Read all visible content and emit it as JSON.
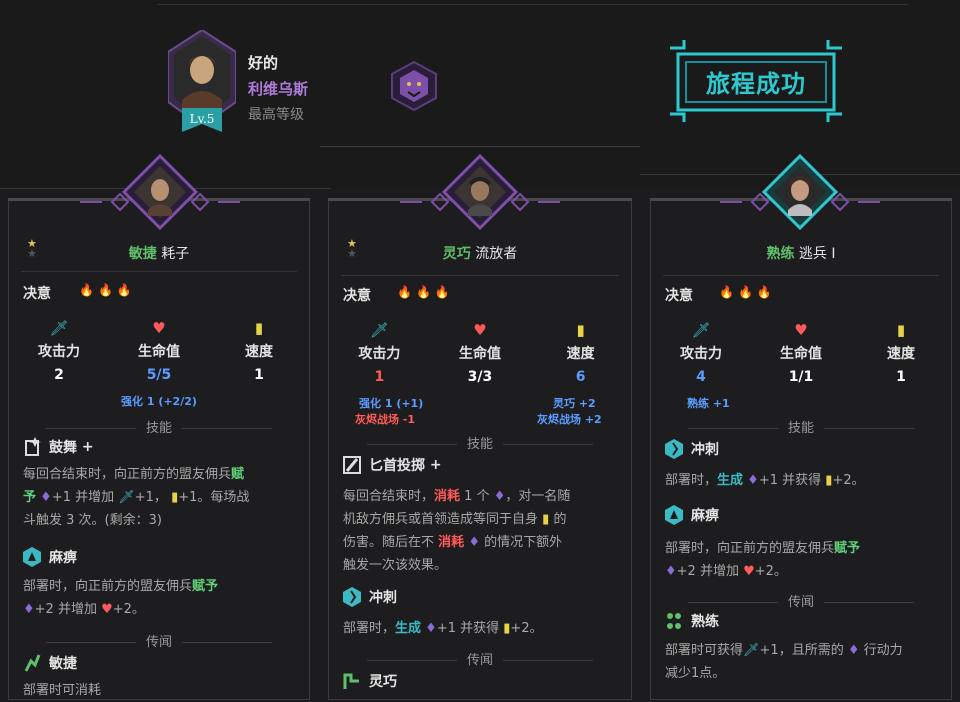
{
  "hero": {
    "mood": "好的",
    "name": "利维乌斯",
    "level_text": "最高等级",
    "badge": "Lv.5"
  },
  "banner": {
    "text": "旅程成功"
  },
  "colors": {
    "accent": "#2ec9cf",
    "purple": "#7d4fa8",
    "trait_green": "#5fbf6a",
    "red": "#ff5a5a",
    "blue": "#5a9dff"
  },
  "cards": [
    {
      "trait": "敏捷",
      "cls": "耗子",
      "resolve": "决意",
      "stats": {
        "atk_label": "攻击力",
        "atk": "2",
        "hp_label": "生命值",
        "hp": "5/5",
        "spd_label": "速度",
        "spd": "1"
      },
      "mod_line": "强化 1 (+2/2)",
      "skills_header": "技能",
      "skill1": {
        "name": "鼓舞",
        "plus": "+",
        "l1a": "每回合结束时，向正前方的盟友佣兵",
        "l1b": "赋",
        "l2a": "予",
        "l2b": "+1 并增加",
        "l2c": "+1，",
        "l2d": "+1。每场战",
        "l3": "斗触发 3 次。(剩余：3)"
      },
      "skill2": {
        "name": "麻痹",
        "l1a": "部署时，向正前方的盟友佣兵",
        "l1b": "赋予",
        "l2a": "+2 并增加",
        "l2b": "+2。"
      },
      "lore_header": "传闻",
      "skill3": {
        "name": "敏捷",
        "l1": "部署时可消耗"
      }
    },
    {
      "trait": "灵巧",
      "cls": "流放者",
      "resolve": "决意",
      "stats": {
        "atk_label": "攻击力",
        "atk": "1",
        "hp_label": "生命值",
        "hp": "3/3",
        "spd_label": "速度",
        "spd": "6"
      },
      "mod_atk1": "强化 1 (+1)",
      "mod_atk2": "灰烬战场 -1",
      "mod_spd1": "灵巧 +2",
      "mod_spd2": "灰烬战场 +2",
      "skills_header": "技能",
      "skill1": {
        "name": "匕首投掷",
        "plus": "+",
        "l1a": "每回合结束时，",
        "l1b": "消耗",
        "l1c": "1 个",
        "l1d": "，对一名随",
        "l2a": "机敌方佣兵或首领造成等同于自身",
        "l2b": "的",
        "l3a": "伤害。随后在不",
        "l3b": "消耗",
        "l3c": "的情况下额外",
        "l4": "触发一次该效果。"
      },
      "skill2": {
        "name": "冲刺",
        "l1a": "部署时，",
        "l1b": "生成",
        "l1c": "+1 并获得",
        "l1d": "+2。"
      },
      "lore_header": "传闻",
      "skill3": {
        "name": "灵巧"
      }
    },
    {
      "trait": "熟练",
      "cls": "逃兵 I",
      "resolve": "决意",
      "stats": {
        "atk_label": "攻击力",
        "atk": "4",
        "hp_label": "生命值",
        "hp": "1/1",
        "spd_label": "速度",
        "spd": "1"
      },
      "mod_atk": "熟练 +1",
      "skills_header": "技能",
      "skill1": {
        "name": "冲刺",
        "l1a": "部署时，",
        "l1b": "生成",
        "l1c": "+1 并获得",
        "l1d": "+2。"
      },
      "skill2": {
        "name": "麻痹",
        "l1a": "部署时，向正前方的盟友佣兵",
        "l1b": "赋予",
        "l2a": "+2 并增加",
        "l2b": "+2。"
      },
      "lore_header": "传闻",
      "skill3": {
        "name": "熟练",
        "l1a": "部署时可获得",
        "l1b": "+1，且所需的",
        "l1c": "行动力",
        "l2": "减少1点。"
      }
    }
  ]
}
